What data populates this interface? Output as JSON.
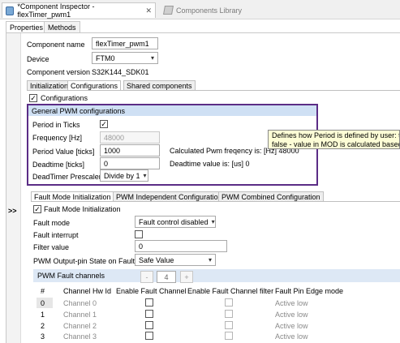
{
  "editor_tabs": {
    "active_label": "*Component Inspector - flexTimer_pwm1",
    "inactive_label": "Components Library"
  },
  "view_tabs": [
    "Properties",
    "Methods"
  ],
  "component": {
    "name_label": "Component name",
    "name_value": "flexTimer_pwm1",
    "device_label": "Device",
    "device_value": "FTM0",
    "version_label": "Component version",
    "version_value": "S32K144_SDK01"
  },
  "section_tabs": [
    "Initialization",
    "Configurations",
    "Shared components"
  ],
  "configurations_checkbox": "Configurations",
  "gutter_expand": ">>",
  "pwm_group": {
    "title": "General PWM configurations",
    "period_in_ticks_label": "Period in Ticks",
    "period_in_ticks_checked": "✓",
    "frequency_label": "Frequency [Hz]",
    "frequency_value": "48000",
    "period_value_label": "Period Value [ticks]",
    "period_value": "1000",
    "calc_freq_text": "Calculated Pwm freqency is: [Hz] 48000",
    "deadtime_label": "Deadtime [ticks]",
    "deadtime_value": "0",
    "deadtime_value_text": "Deadtime value is: [us] 0",
    "prescaler_label": "DeadTimer Prescaler",
    "prescaler_value": "Divide by 1"
  },
  "tooltip": {
    "line1": "Defines how Period is defined by user: true",
    "line2": "false - value in MOD is calculated based on"
  },
  "fault_tabs": [
    "Fault Mode Initialization",
    "PWM Independent Configuration",
    "PWM Combined Configuration"
  ],
  "fault": {
    "init_checkbox": "Fault Mode Initialization",
    "init_checked": "✓",
    "mode_label": "Fault mode",
    "mode_value": "Fault control disabled",
    "interrupt_label": "Fault interrupt",
    "filter_label": "Filter value",
    "filter_value": "0",
    "output_state_label": "PWM Output-pin State on Fault",
    "output_state_value": "Safe Value"
  },
  "fault_channels": {
    "title": "PWM Fault channels",
    "minus": "-",
    "count": "4",
    "plus": "+",
    "headers": [
      "#",
      "Channel Hw Id",
      "Enable Fault Channel",
      "Enable Fault Channel filter",
      "Fault Pin Edge mode"
    ],
    "rows": [
      {
        "index": "0",
        "channel": "Channel 0",
        "edge": "Active low"
      },
      {
        "index": "1",
        "channel": "Channel 1",
        "edge": "Active low"
      },
      {
        "index": "2",
        "channel": "Channel 2",
        "edge": "Active low"
      },
      {
        "index": "3",
        "channel": "Channel 3",
        "edge": "Active low"
      }
    ]
  },
  "icons": {
    "check": "check-icon",
    "dropdown": "chevron-down-icon",
    "close": "close-icon",
    "component": "component-icon",
    "library": "library-icon"
  }
}
